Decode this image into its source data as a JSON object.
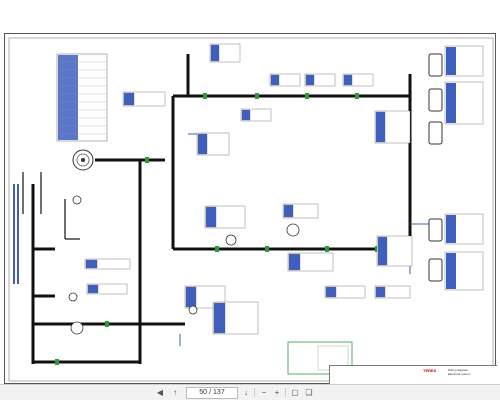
{
  "document": {
    "title_block": {
      "brand": "TEREX",
      "line1": "Wiring diagram",
      "line2": "Electrical system"
    }
  },
  "viewer": {
    "current_page": "50",
    "separator": "/",
    "total_pages": "137",
    "zoom_out_glyph": "−",
    "zoom_in_glyph": "+"
  },
  "colors": {
    "harness": "#111111",
    "label_blue": "#3f5fbf",
    "highlight_green": "#2e9a3a",
    "frame": "#555555"
  }
}
